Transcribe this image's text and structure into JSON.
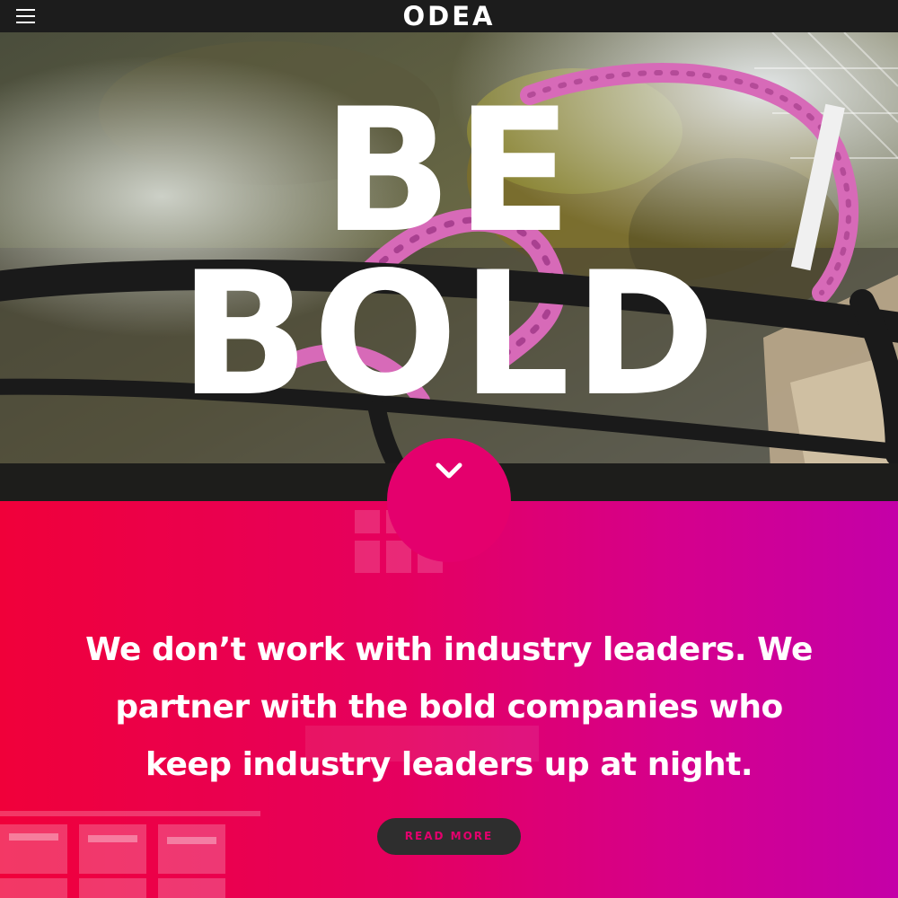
{
  "header": {
    "logo_text": "ODEA",
    "menu_icon": "hamburger-menu-icon"
  },
  "hero": {
    "headline_line1": "BE",
    "headline_line2": "BOLD",
    "scroll_icon": "chevron-down-icon"
  },
  "promo": {
    "statement": "We don’t work with industry leaders. We partner with the bold companies who keep industry leaders up at night.",
    "read_more_label": "READ MORE"
  },
  "colors": {
    "accent": "#e4006d",
    "bar": "#1c1c1c",
    "button_bg": "#2e2e2e"
  }
}
